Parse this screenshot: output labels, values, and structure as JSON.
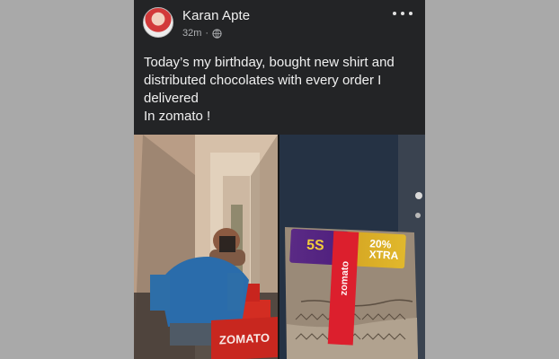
{
  "post": {
    "author": "Karan Apte",
    "time": "32m",
    "separator": "·",
    "lines": [
      "Today’s my birthday, bought new shirt and",
      "distributed chocolates with every order I",
      "delivered",
      "In zomato !"
    ]
  },
  "media": {
    "left_photo_brand": "ZOMATO",
    "right_photo": {
      "tape_label": "zomato",
      "choc_main": "5S",
      "choc_percent": "20%",
      "choc_extra": "XTRA"
    }
  },
  "icons": {
    "more": "more-options-icon",
    "audience": "globe-icon"
  },
  "colors": {
    "card_background": "#232426",
    "page_background": "#a9a9a9",
    "brand_red": "#c8271f"
  }
}
